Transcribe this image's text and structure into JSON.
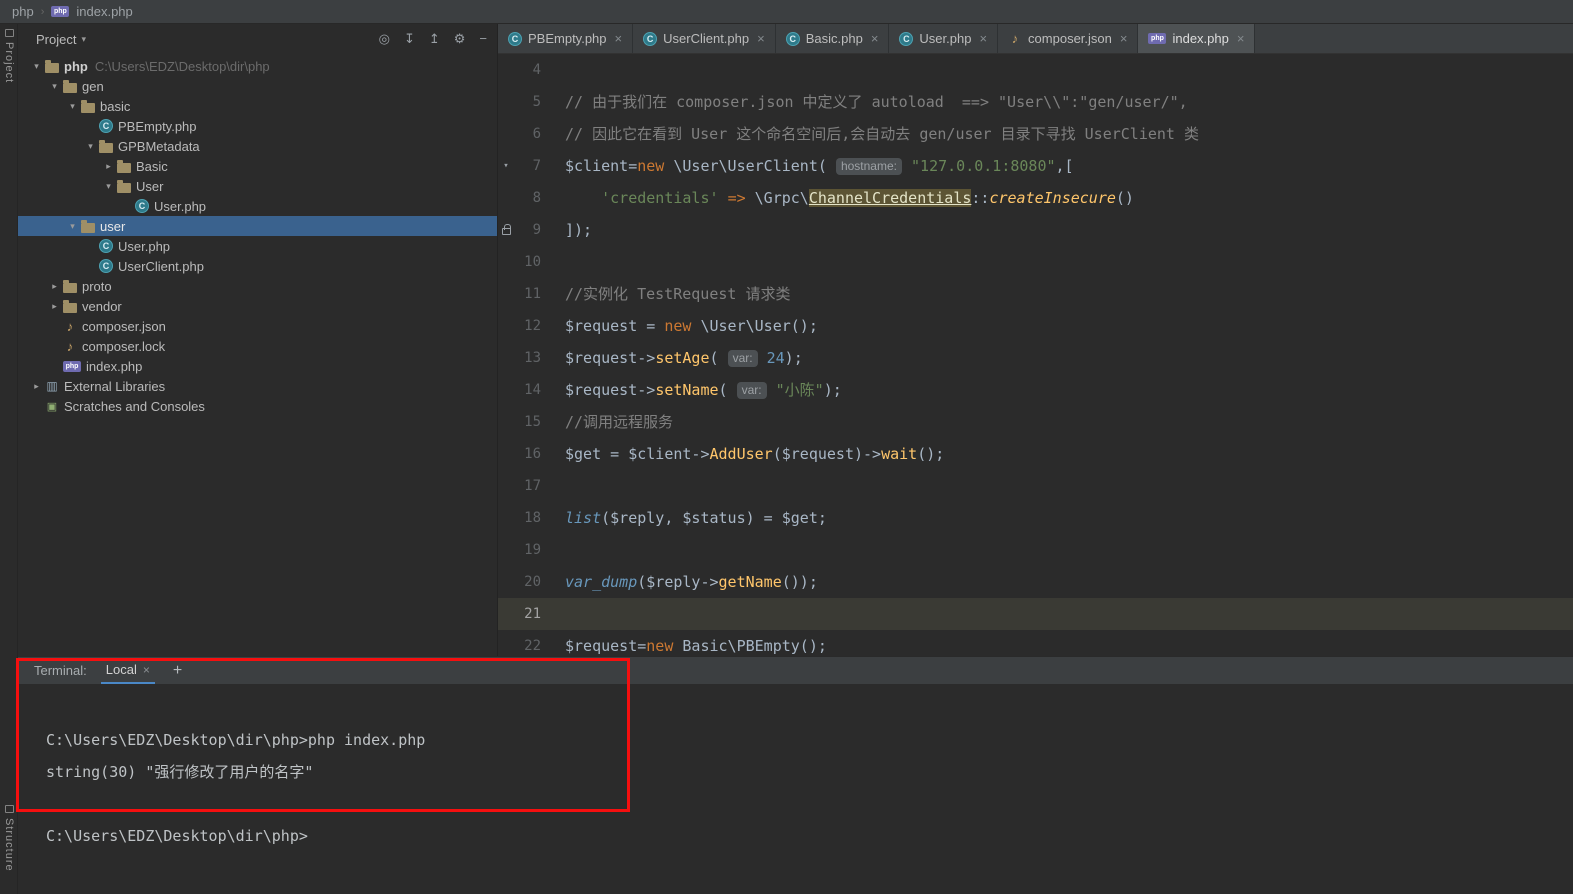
{
  "colors": {
    "selection_blue": "#3a628e",
    "annotation_red": "#f50f0f",
    "keyword_orange": "#cc7832",
    "string_green": "#6a8759",
    "function_yellow": "#ffc66b",
    "comment_gray": "#808080",
    "number_blue": "#6897bb"
  },
  "breadcrumb": {
    "segments": [
      {
        "label": "php"
      },
      {
        "label": "index.php",
        "icon": "phpfile"
      }
    ]
  },
  "tool_strips": {
    "left_top": "Project",
    "left_bottom": "Structure"
  },
  "project_panel": {
    "header": {
      "title": "Project",
      "dropdown_icon": "chevron-down-icon",
      "icons": [
        "locate",
        "collapse-all",
        "expand-all",
        "settings",
        "hide-window"
      ]
    },
    "tree": [
      {
        "level": 0,
        "state": "expanded",
        "icon": "folder",
        "label": "php",
        "bold": true,
        "suffix": "C:\\Users\\EDZ\\Desktop\\dir\\php"
      },
      {
        "level": 1,
        "state": "expanded",
        "icon": "folder",
        "label": "gen"
      },
      {
        "level": 2,
        "state": "expanded",
        "icon": "folder",
        "label": "basic"
      },
      {
        "level": 3,
        "state": "none",
        "icon": "phpclass",
        "label": "PBEmpty.php"
      },
      {
        "level": 3,
        "state": "expanded",
        "icon": "folder",
        "label": "GPBMetadata"
      },
      {
        "level": 4,
        "state": "collapsed",
        "icon": "folder",
        "label": "Basic"
      },
      {
        "level": 4,
        "state": "expanded",
        "icon": "folder",
        "label": "User"
      },
      {
        "level": 5,
        "state": "none",
        "icon": "phpclass",
        "label": "User.php"
      },
      {
        "level": 2,
        "state": "expanded",
        "icon": "folder",
        "label": "user",
        "selected": true
      },
      {
        "level": 3,
        "state": "none",
        "icon": "phpclass",
        "label": "User.php"
      },
      {
        "level": 3,
        "state": "none",
        "icon": "phpclass",
        "label": "UserClient.php"
      },
      {
        "level": 1,
        "state": "collapsed",
        "icon": "folder",
        "label": "proto"
      },
      {
        "level": 1,
        "state": "collapsed",
        "icon": "folder",
        "label": "vendor"
      },
      {
        "level": 1,
        "state": "none",
        "icon": "composer",
        "label": "composer.json"
      },
      {
        "level": 1,
        "state": "none",
        "icon": "composer",
        "label": "composer.lock"
      },
      {
        "level": 1,
        "state": "none",
        "icon": "phpfile",
        "label": "index.php"
      },
      {
        "level": 0,
        "state": "collapsed",
        "icon": "library",
        "label": "External Libraries"
      },
      {
        "level": 0,
        "state": "none",
        "icon": "scratches",
        "label": "Scratches and Consoles"
      }
    ]
  },
  "editor": {
    "tabs": [
      {
        "label": "PBEmpty.php",
        "icon": "phpclass"
      },
      {
        "label": "UserClient.php",
        "icon": "phpclass"
      },
      {
        "label": "Basic.php",
        "icon": "phpclass"
      },
      {
        "label": "User.php",
        "icon": "phpclass"
      },
      {
        "label": "composer.json",
        "icon": "composer"
      },
      {
        "label": "index.php",
        "icon": "phpfile",
        "active": true
      }
    ],
    "lines": [
      {
        "num": 4,
        "tokens": []
      },
      {
        "num": 5,
        "tokens": [
          [
            "// 由于我们在 composer.json 中定义了 autoload  ==> \"User\\\\\":\"gen/user/\",",
            "cmt"
          ]
        ]
      },
      {
        "num": 6,
        "tokens": [
          [
            "// 因此它在看到 User 这个命名空间后,会自动去 gen/user 目录下寻找 UserClient 类",
            "cmt"
          ]
        ]
      },
      {
        "num": 7,
        "gutter": "fold",
        "tokens": [
          [
            "$client",
            "def"
          ],
          [
            "=",
            "def"
          ],
          [
            "new",
            "kw"
          ],
          [
            " \\User\\UserClient( ",
            "def"
          ],
          [
            "hostname:",
            "hint"
          ],
          [
            " ",
            "def"
          ],
          [
            "\"127.0.0.1:8080\"",
            "str"
          ],
          [
            ",[",
            "def"
          ]
        ]
      },
      {
        "num": 8,
        "tokens": [
          [
            "    ",
            "def"
          ],
          [
            "'credentials'",
            "str"
          ],
          [
            " ",
            "def"
          ],
          [
            "=>",
            "kw"
          ],
          [
            " \\Grpc\\",
            "def"
          ],
          [
            "ChannelCredentials",
            "usage"
          ],
          [
            "::",
            "def"
          ],
          [
            "createInsecure",
            "fni"
          ],
          [
            "()",
            "def"
          ]
        ]
      },
      {
        "num": 9,
        "gutter": "lock",
        "tokens": [
          [
            "]);",
            "def"
          ]
        ]
      },
      {
        "num": 10,
        "tokens": []
      },
      {
        "num": 11,
        "tokens": [
          [
            "//实例化 TestRequest 请求类",
            "cmt"
          ]
        ]
      },
      {
        "num": 12,
        "tokens": [
          [
            "$request = ",
            "def"
          ],
          [
            "new",
            "kw"
          ],
          [
            " \\User\\User();",
            "def"
          ]
        ]
      },
      {
        "num": 13,
        "tokens": [
          [
            "$request->",
            "def"
          ],
          [
            "setAge",
            "fn"
          ],
          [
            "( ",
            "def"
          ],
          [
            "var:",
            "hint"
          ],
          [
            " ",
            "def"
          ],
          [
            "24",
            "num"
          ],
          [
            ");",
            "def"
          ]
        ]
      },
      {
        "num": 14,
        "tokens": [
          [
            "$request->",
            "def"
          ],
          [
            "setName",
            "fn"
          ],
          [
            "( ",
            "def"
          ],
          [
            "var:",
            "hint"
          ],
          [
            " ",
            "def"
          ],
          [
            "\"小陈\"",
            "str"
          ],
          [
            ");",
            "def"
          ]
        ]
      },
      {
        "num": 15,
        "tokens": [
          [
            "//调用远程服务",
            "cmt"
          ]
        ]
      },
      {
        "num": 16,
        "tokens": [
          [
            "$get = $client->",
            "def"
          ],
          [
            "AddUser",
            "fn"
          ],
          [
            "($request)->",
            "def"
          ],
          [
            "wait",
            "fn"
          ],
          [
            "();",
            "def"
          ]
        ]
      },
      {
        "num": 17,
        "tokens": []
      },
      {
        "num": 18,
        "tokens": [
          [
            "list",
            "pre"
          ],
          [
            "($reply, $status) = $get;",
            "def"
          ]
        ]
      },
      {
        "num": 19,
        "tokens": []
      },
      {
        "num": 20,
        "tokens": [
          [
            "var_dump",
            "pre"
          ],
          [
            "($reply->",
            "def"
          ],
          [
            "getName",
            "fn"
          ],
          [
            "());",
            "def"
          ]
        ]
      },
      {
        "num": 21,
        "caret": true,
        "tokens": []
      },
      {
        "num": 22,
        "tokens": [
          [
            "$request=",
            "def"
          ],
          [
            "new",
            "kw"
          ],
          [
            " Basic\\PBEmpty();",
            "def"
          ]
        ]
      }
    ]
  },
  "terminal": {
    "label": "Terminal:",
    "tabs": [
      {
        "label": "Local",
        "active": true
      }
    ],
    "new_tab_icon": "plus-icon",
    "lines": [
      "C:\\Users\\EDZ\\Desktop\\dir\\php>php index.php",
      "string(30) \"强行修改了用户的名字\"",
      "",
      "C:\\Users\\EDZ\\Desktop\\dir\\php>"
    ]
  },
  "annotation": {
    "shape": "rectangle",
    "color": "#f50f0f",
    "purpose": "highlight-terminal-output"
  }
}
